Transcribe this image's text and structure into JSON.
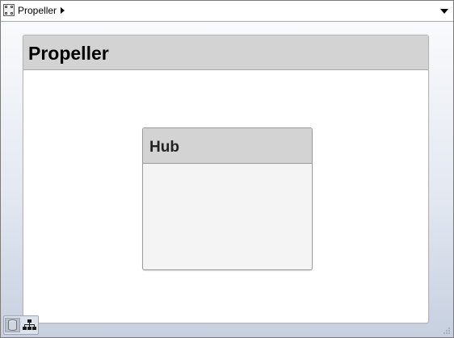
{
  "breadcrumb": {
    "icon": "model-icon",
    "label": "Propeller"
  },
  "canvas": {
    "outer_block": {
      "title": "Propeller"
    },
    "inner_block": {
      "title": "Hub"
    }
  },
  "toolbar": {
    "buttons": [
      {
        "icon": "database-icon"
      },
      {
        "icon": "hierarchy-icon"
      }
    ]
  },
  "colors": {
    "header_gray": "#d3d3d3",
    "canvas_gradient_top": "#f9fafc",
    "canvas_gradient_bottom": "#c7d0e0"
  }
}
